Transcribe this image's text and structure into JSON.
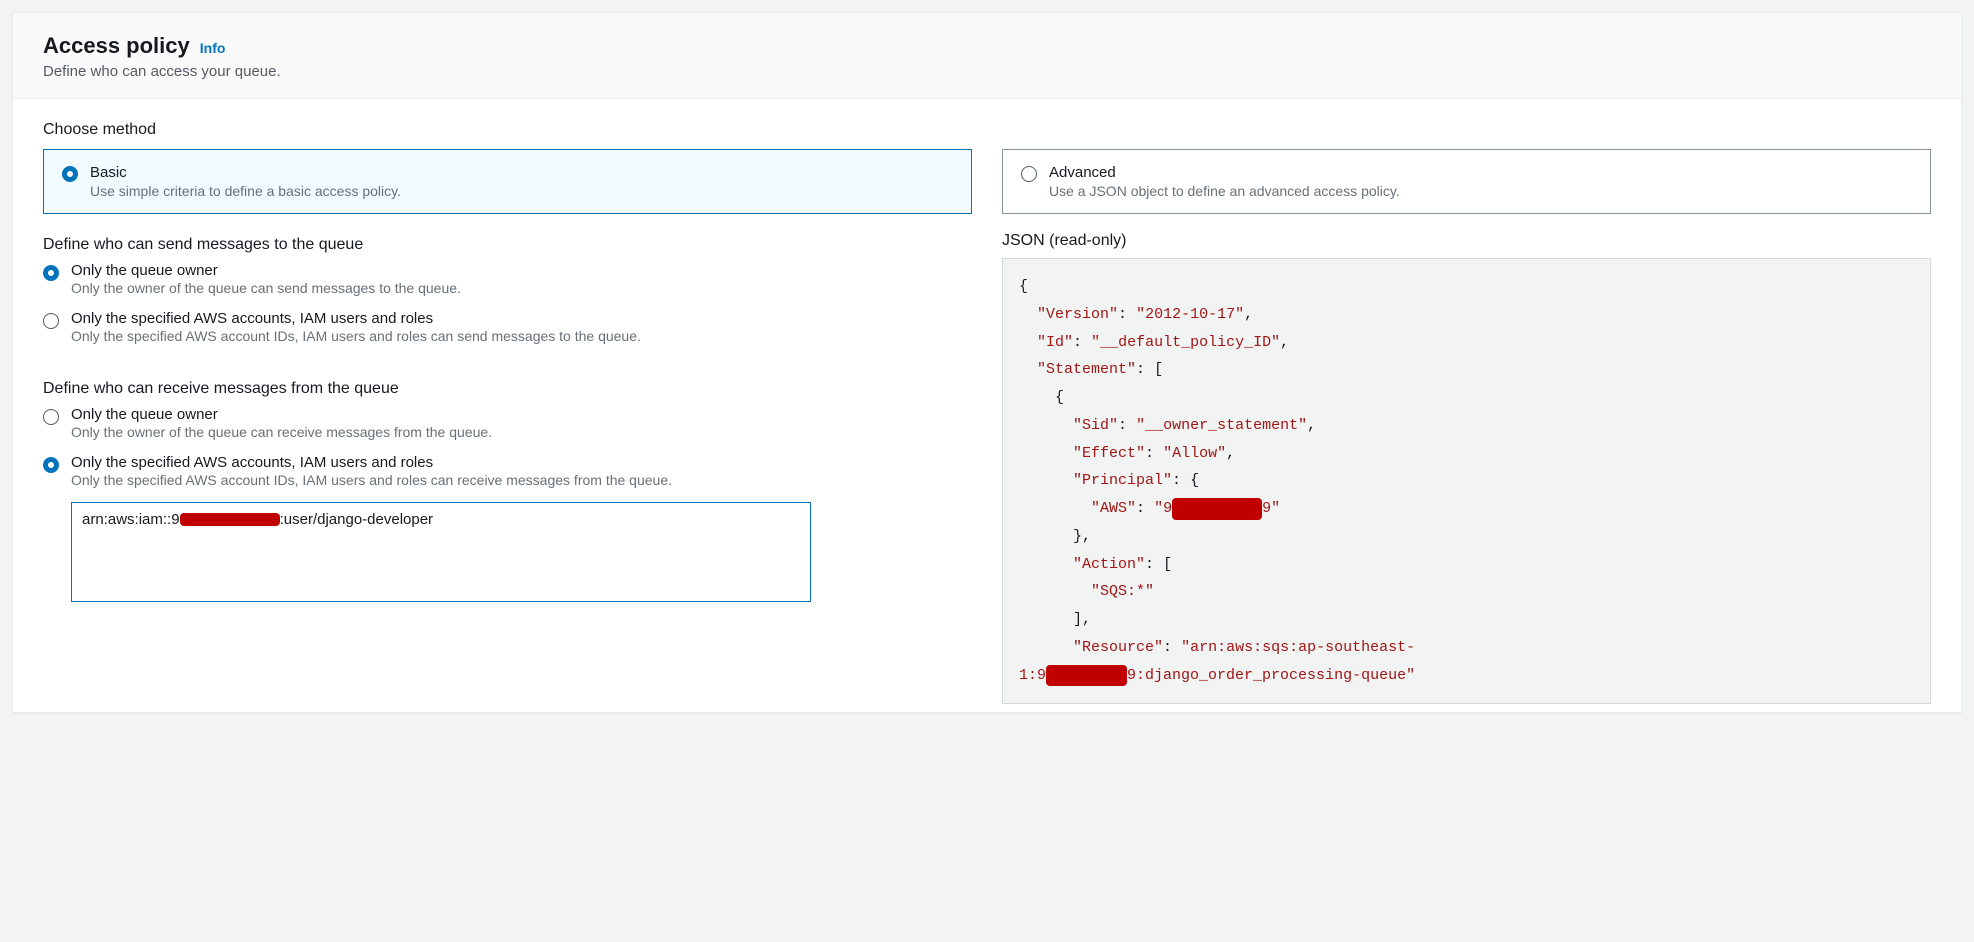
{
  "header": {
    "title": "Access policy",
    "info_label": "Info",
    "subtitle": "Define who can access your queue."
  },
  "choose_method": {
    "label": "Choose method",
    "basic": {
      "title": "Basic",
      "desc": "Use simple criteria to define a basic access policy.",
      "selected": true
    },
    "advanced": {
      "title": "Advanced",
      "desc": "Use a JSON object to define an advanced access policy.",
      "selected": false
    }
  },
  "send": {
    "label": "Define who can send messages to the queue",
    "option_owner": {
      "title": "Only the queue owner",
      "desc": "Only the owner of the queue can send messages to the queue.",
      "selected": true
    },
    "option_accounts": {
      "title": "Only the specified AWS accounts, IAM users and roles",
      "desc": "Only the specified AWS account IDs, IAM users and roles can send messages to the queue.",
      "selected": false
    }
  },
  "receive": {
    "label": "Define who can receive messages from the queue",
    "option_owner": {
      "title": "Only the queue owner",
      "desc": "Only the owner of the queue can receive messages from the queue.",
      "selected": false
    },
    "option_accounts": {
      "title": "Only the specified AWS accounts, IAM users and roles",
      "desc": "Only the specified AWS account IDs, IAM users and roles can receive messages from the queue.",
      "selected": true
    },
    "arn_prefix": "arn:aws:iam::9",
    "arn_redacted": "XXXXXXXXXX",
    "arn_suffix": ":user/django-developer"
  },
  "json": {
    "label": "JSON (read-only)",
    "version": "2012-10-17",
    "id": "__default_policy_ID",
    "sid": "__owner_statement",
    "effect": "Allow",
    "aws_principal_prefix": "9",
    "aws_principal_redacted": "XXXXXXXXXX",
    "aws_principal_suffix": "9",
    "action": "SQS:*",
    "resource_line1": "arn:aws:sqs:ap-southeast-",
    "resource_line2_prefix": "1:9",
    "resource_line2_redacted": "XXXXXXXXX",
    "resource_line2_suffix": "9:django_order_processing-queue"
  }
}
